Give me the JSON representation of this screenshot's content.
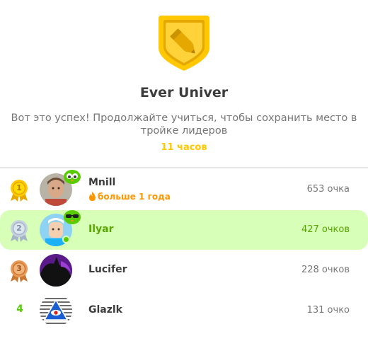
{
  "league": {
    "title": "Ever Univer",
    "message": "Вот это успех! Продолжайте учиться, чтобы сохранить место в тройке лидеров",
    "time_left": "11 часов",
    "badge_icon": "gold-league-badge-icon"
  },
  "colors": {
    "accent_green": "#58cc02",
    "highlight_bg": "#d7ffb8",
    "gold": "#ffc800",
    "streak_orange": "#ff9600"
  },
  "leaderboard": [
    {
      "rank": "1",
      "name": "Mnill",
      "streak": "больше 1 года",
      "xp": "653 очка",
      "medal": "gold"
    },
    {
      "rank": "2",
      "name": "Ilyar",
      "xp": "427 очков",
      "medal": "silver",
      "current_user": true
    },
    {
      "rank": "3",
      "name": "Lucifer",
      "xp": "228 очков",
      "medal": "bronze"
    },
    {
      "rank": "4",
      "name": "Glazlk",
      "xp": "131 очко"
    }
  ]
}
